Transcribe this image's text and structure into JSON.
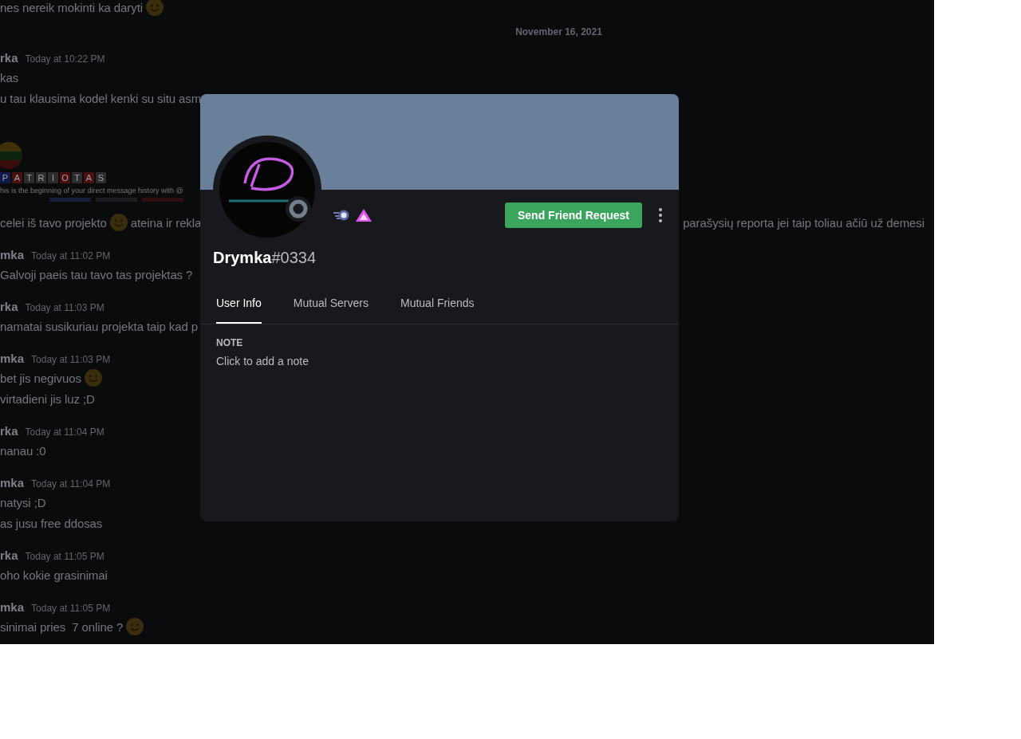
{
  "chat": {
    "lines": [
      {
        "kind": "text",
        "parts": [
          {
            "kind": "text",
            "text": "nes nereik mokinti ka daryti"
          },
          {
            "kind": "emoji"
          }
        ]
      },
      {
        "kind": "date_divider",
        "text": "November 16, 2021"
      },
      {
        "kind": "header",
        "author": "rka",
        "time": "Today at 10:22 PM"
      },
      {
        "kind": "text",
        "parts": [
          {
            "kind": "text",
            "text": "kas"
          }
        ]
      },
      {
        "kind": "text",
        "parts": [
          {
            "kind": "text",
            "text": "u tau klausima kodel kenki su situ asm"
          }
        ]
      },
      {
        "kind": "dm_intro",
        "tiles": [
          {
            "letter": "P",
            "color": "#0d1b4d"
          },
          {
            "letter": "A",
            "color": "#4a0f0f"
          },
          {
            "letter": "T",
            "color": "#2c2c2e"
          },
          {
            "letter": "R",
            "color": "#2c2c2e"
          },
          {
            "letter": "I",
            "color": "#2c2c2e"
          },
          {
            "letter": "O",
            "color": "#4a0f0f"
          },
          {
            "letter": "T",
            "color": "#2c2c2e"
          },
          {
            "letter": "A",
            "color": "#4a0f0f"
          },
          {
            "letter": "S",
            "color": "#2c2c2e"
          }
        ],
        "intro_text": "his is the beginning of your direct message history with @"
      },
      {
        "kind": "text",
        "parts": [
          {
            "kind": "text",
            "text": "celei iš tavo projekto"
          },
          {
            "kind": "emoji"
          },
          {
            "kind": "text",
            "text": "ateina ir rekla"
          }
        ],
        "trailing": "parašysių reporta jei taip toliau ačiū už demesi"
      },
      {
        "kind": "header",
        "author": "mka",
        "time": "Today at 11:02 PM"
      },
      {
        "kind": "text",
        "parts": [
          {
            "kind": "text",
            "text": "Galvoji paeis tau tavo tas projektas ?"
          }
        ]
      },
      {
        "kind": "header",
        "author": "rka",
        "time": "Today at 11:03 PM"
      },
      {
        "kind": "text",
        "parts": [
          {
            "kind": "text",
            "text": "namatai susikuriau projekta taip kad p"
          }
        ]
      },
      {
        "kind": "header",
        "author": "mka",
        "time": "Today at 11:03 PM"
      },
      {
        "kind": "text",
        "parts": [
          {
            "kind": "text",
            "text": "bet jis negivuos"
          },
          {
            "kind": "emoji"
          }
        ]
      },
      {
        "kind": "text",
        "parts": [
          {
            "kind": "text",
            "text": "virtadieni jis luz ;D"
          }
        ]
      },
      {
        "kind": "header",
        "author": "rka",
        "time": "Today at 11:04 PM"
      },
      {
        "kind": "text",
        "parts": [
          {
            "kind": "text",
            "text": "nanau :0"
          }
        ]
      },
      {
        "kind": "header",
        "author": "mka",
        "time": "Today at 11:04 PM"
      },
      {
        "kind": "text",
        "parts": [
          {
            "kind": "text",
            "text": "natysi ;D"
          }
        ]
      },
      {
        "kind": "text",
        "parts": [
          {
            "kind": "text",
            "text": "as jusu free ddosas"
          }
        ]
      },
      {
        "kind": "header",
        "author": "rka",
        "time": "Today at 11:05 PM"
      },
      {
        "kind": "text",
        "parts": [
          {
            "kind": "text",
            "text": "oho kokie grasinimai"
          }
        ]
      },
      {
        "kind": "header",
        "author": "mka",
        "time": "Today at 11:05 PM"
      },
      {
        "kind": "text",
        "parts": [
          {
            "kind": "text",
            "text": "sinimai pries  7 online ?"
          },
          {
            "kind": "emoji"
          }
        ]
      }
    ]
  },
  "profile": {
    "name": "Drymka",
    "discriminator": "#0334",
    "action_button": "Send Friend Request",
    "tabs": [
      {
        "label": "User Info",
        "selected": true
      },
      {
        "label": "Mutual Servers",
        "selected": false
      },
      {
        "label": "Mutual Friends",
        "selected": false
      }
    ],
    "note": {
      "heading": "NOTE",
      "placeholder": "Click to add a note"
    }
  }
}
